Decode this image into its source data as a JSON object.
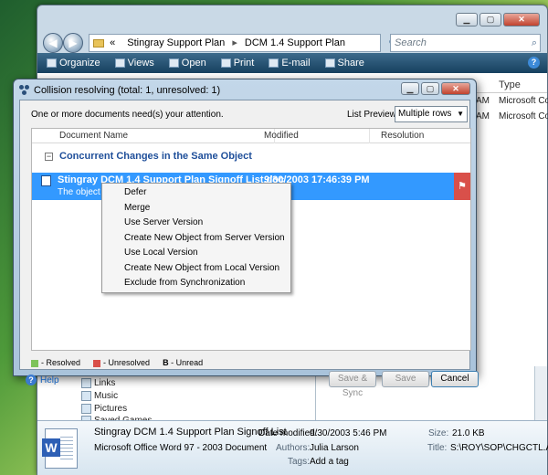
{
  "explorer": {
    "address": {
      "root_marker": "«",
      "crumbs": [
        "Stingray Support Plan",
        "DCM 1.4 Support Plan"
      ]
    },
    "search_placeholder": "Search",
    "toolbar": [
      "Organize",
      "Views",
      "Open",
      "Print",
      "E-mail",
      "Share"
    ],
    "columns": {
      "type": "Type"
    },
    "files": [
      {
        "time_suffix": "AM",
        "type": "Microsoft Co"
      },
      {
        "time_suffix": "AM",
        "type": "Microsoft Co"
      }
    ],
    "tree": [
      "Links",
      "Music",
      "Pictures",
      "Saved Games"
    ],
    "details": {
      "file_name": "Stingray DCM 1.4 Support Plan Signoff List",
      "date_modified_label": "Date modified:",
      "date_modified": "9/30/2003 5:46 PM",
      "size_label": "Size:",
      "size": "21.0 KB",
      "file_type": "Microsoft Office Word 97 - 2003 Document",
      "authors_label": "Authors:",
      "authors": "Julia Larson",
      "title_label": "Title:",
      "title": "S:\\ROY\\SOP\\CHGCTL.A...",
      "tags_label": "Tags:",
      "tags": "Add a tag"
    }
  },
  "dialog": {
    "title": "Collision resolving (total: 1, unresolved: 1)",
    "attention": "One or more documents need(s) your attention.",
    "list_preview_label": "List Preview:",
    "list_preview_value": "Multiple rows",
    "columns": [
      "Document Name",
      "Modified",
      "Resolution"
    ],
    "group_label": "Concurrent Changes in the Same Object",
    "row": {
      "name": "Stingray DCM 1.4 Support Plan Signoff List.doc",
      "modified": "9/30/2003 17:46:39 PM",
      "description": "The object was"
    },
    "legend": [
      {
        "label": "- Resolved",
        "color": "#7dc35a"
      },
      {
        "label": "- Unresolved",
        "color": "#d9504a"
      },
      {
        "marker": "B",
        "label": "- Unread"
      }
    ],
    "help_label": "Help",
    "buttons": {
      "save_sync": "Save & Sync",
      "save": "Save",
      "cancel": "Cancel"
    }
  },
  "context_menu": [
    "Defer",
    "Merge",
    "Use Server Version",
    "Create New Object from Server Version",
    "Use Local Version",
    "Create New Object from Local Version",
    "Exclude from Synchronization"
  ],
  "colors": {
    "selection": "#3399ff",
    "group_text": "#1f4f9a",
    "unresolved": "#d9504a",
    "resolved": "#7dc35a"
  }
}
